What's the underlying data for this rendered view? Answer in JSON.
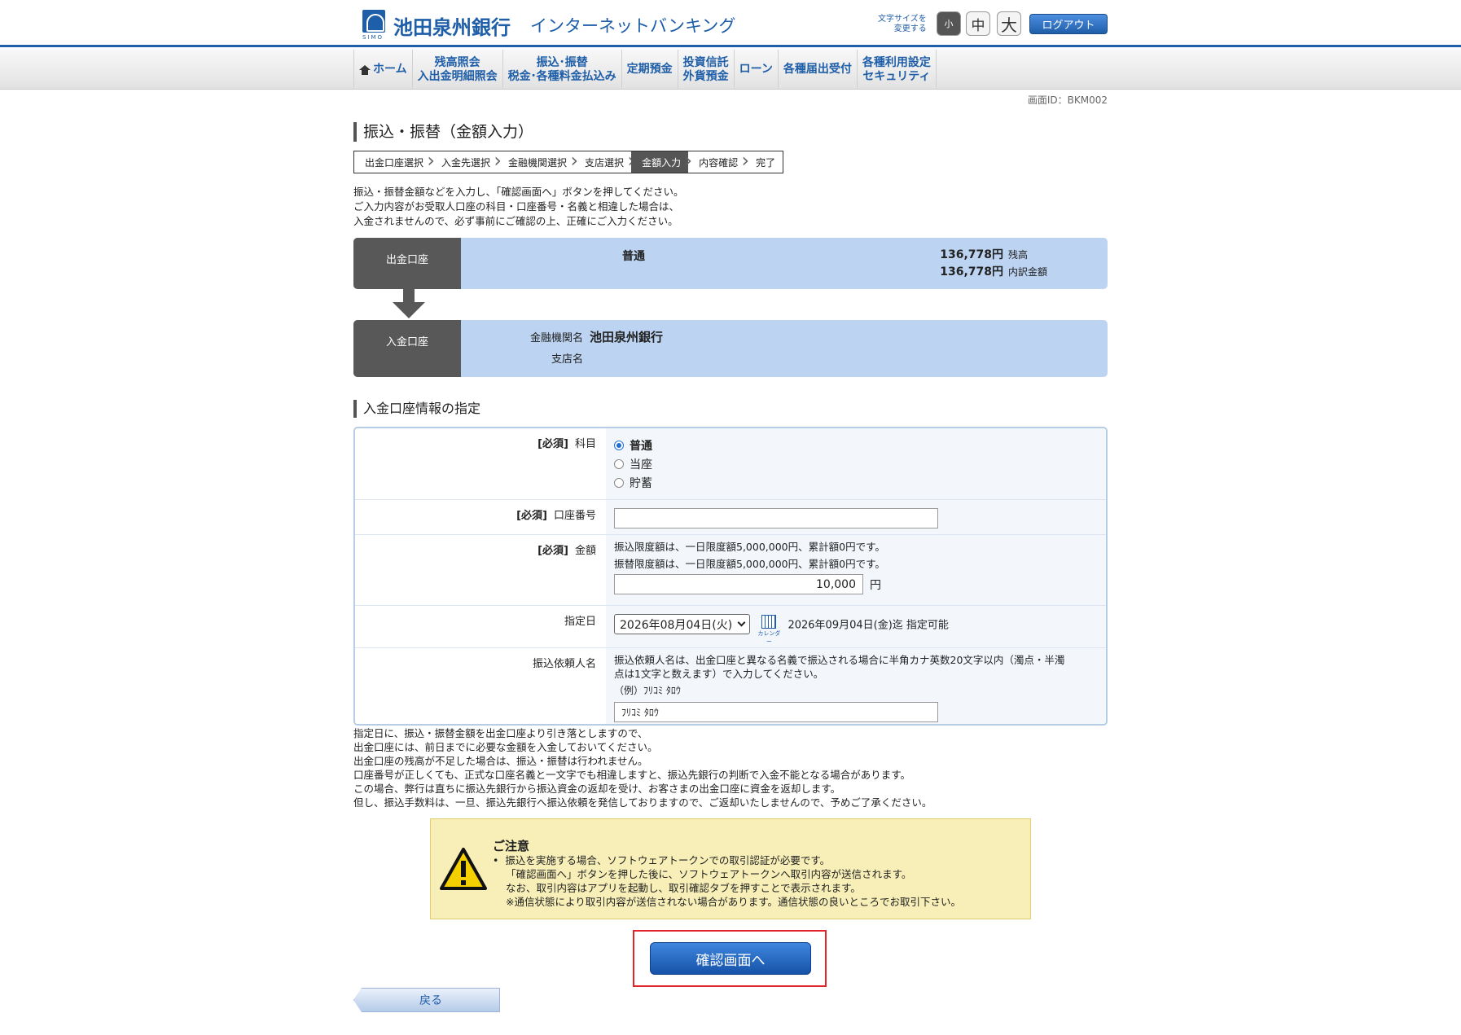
{
  "header": {
    "logo_sub": "SIMO",
    "bank_name": "池田泉州銀行",
    "service_name": "インターネットバンキング",
    "fontsize_label_1": "文字サイズを",
    "fontsize_label_2": "変更する",
    "fontsize_small": "小",
    "fontsize_mid": "中",
    "fontsize_large": "大",
    "logout": "ログアウト"
  },
  "nav": {
    "home": "ホーム",
    "balance_1": "残高照会",
    "balance_2": "入出金明細照会",
    "transfer_1": "振込･振替",
    "transfer_2": "税金･各種料金払込み",
    "time_deposit": "定期預金",
    "invest_1": "投資信託",
    "invest_2": "外貨預金",
    "loan": "ローン",
    "notifications": "各種届出受付",
    "settings_1": "各種利用設定",
    "settings_2": "セキュリティ"
  },
  "screen_id": "画面ID：BKM002",
  "page_title": "振込・振替（金額入力）",
  "steps": [
    "出金口座選択",
    "入金先選択",
    "金融機関選択",
    "支店選択",
    "金額入力",
    "内容確認",
    "完了"
  ],
  "intro": [
    "振込・振替金額などを入力し、「確認画面へ」ボタンを押してください。",
    "ご入力内容がお受取人口座の科目・口座番号・名義と相違した場合は、",
    "入金されませんので、必ず事前にご確認の上、正確にご入力ください。"
  ],
  "source": {
    "label": "出金口座",
    "type": "普通",
    "balance": "136,778円",
    "balance_label": "残高",
    "breakdown": "136,778円",
    "breakdown_label": "内訳金額"
  },
  "destination": {
    "label": "入金口座",
    "bank_label": "金融機関名",
    "bank_value": "池田泉州銀行",
    "branch_label": "支店名",
    "branch_value": ""
  },
  "section_title": "入金口座情報の指定",
  "form": {
    "required": "[必須]",
    "subject_label": "科目",
    "subject_options": [
      "普通",
      "当座",
      "貯蓄"
    ],
    "account_label": "口座番号",
    "account_value": "",
    "amount_label": "金額",
    "amount_note_1": "振込限度額は、一日限度額5,000,000円、累計額0円です。",
    "amount_note_2": "振替限度額は、一日限度額5,000,000円、累計額0円です。",
    "amount_value": "10,000",
    "amount_unit": "円",
    "date_label": "指定日",
    "date_value": "2026年08月04日(火)",
    "calendar_caption": "カレンダー",
    "date_limit": "2026年09月04日(金)迄 指定可能",
    "requester_label": "振込依頼人名",
    "requester_note_1": "振込依頼人名は、出金口座と異なる名義で振込される場合に半角カナ英数20文字以内（濁点・半濁",
    "requester_note_2": "点は1文字と数えます）で入力してください。",
    "requester_example": "（例）ﾌﾘｺﾐ ﾀﾛｳ",
    "requester_value": "ﾌﾘｺﾐ ﾀﾛｳ"
  },
  "foot_notes": [
    "指定日に、振込・振替金額を出金口座より引き落としますので、",
    "出金口座には、前日までに必要な金額を入金しておいてください。",
    "出金口座の残高が不足した場合は、振込・振替は行われません。",
    "口座番号が正しくても、正式な口座名義と一文字でも相違しますと、振込先銀行の判断で入金不能となる場合があります。",
    "この場合、弊行は直ちに振込先銀行から振込資金の返却を受け、お客さまの出金口座に資金を返却します。",
    "但し、振込手数料は、一旦、振込先銀行へ振込依頼を発信しておりますので、ご返却いたしませんので、予めご了承ください。"
  ],
  "caution": {
    "title": "ご注意",
    "line_1": "振込を実施する場合、ソフトウェアトークンでの取引認証が必要です。",
    "line_2": "「確認画面へ」ボタンを押した後に、ソフトウェアトークンへ取引内容が送信されます。",
    "line_3": "なお、取引内容はアプリを起動し、取引確認タブを押すことで表示されます。",
    "line_4": "※通信状態により取引内容が送信されない場合があります。通信状態の良いところでお取引下さい。"
  },
  "confirm_button": "確認画面へ",
  "back_button": "戻る",
  "colors": {
    "brand": "#1f5ea8",
    "account_bg": "#bcd4f2",
    "label_bg": "#585858",
    "caution_bg": "#f7efb7",
    "highlight": "#e0262b"
  }
}
